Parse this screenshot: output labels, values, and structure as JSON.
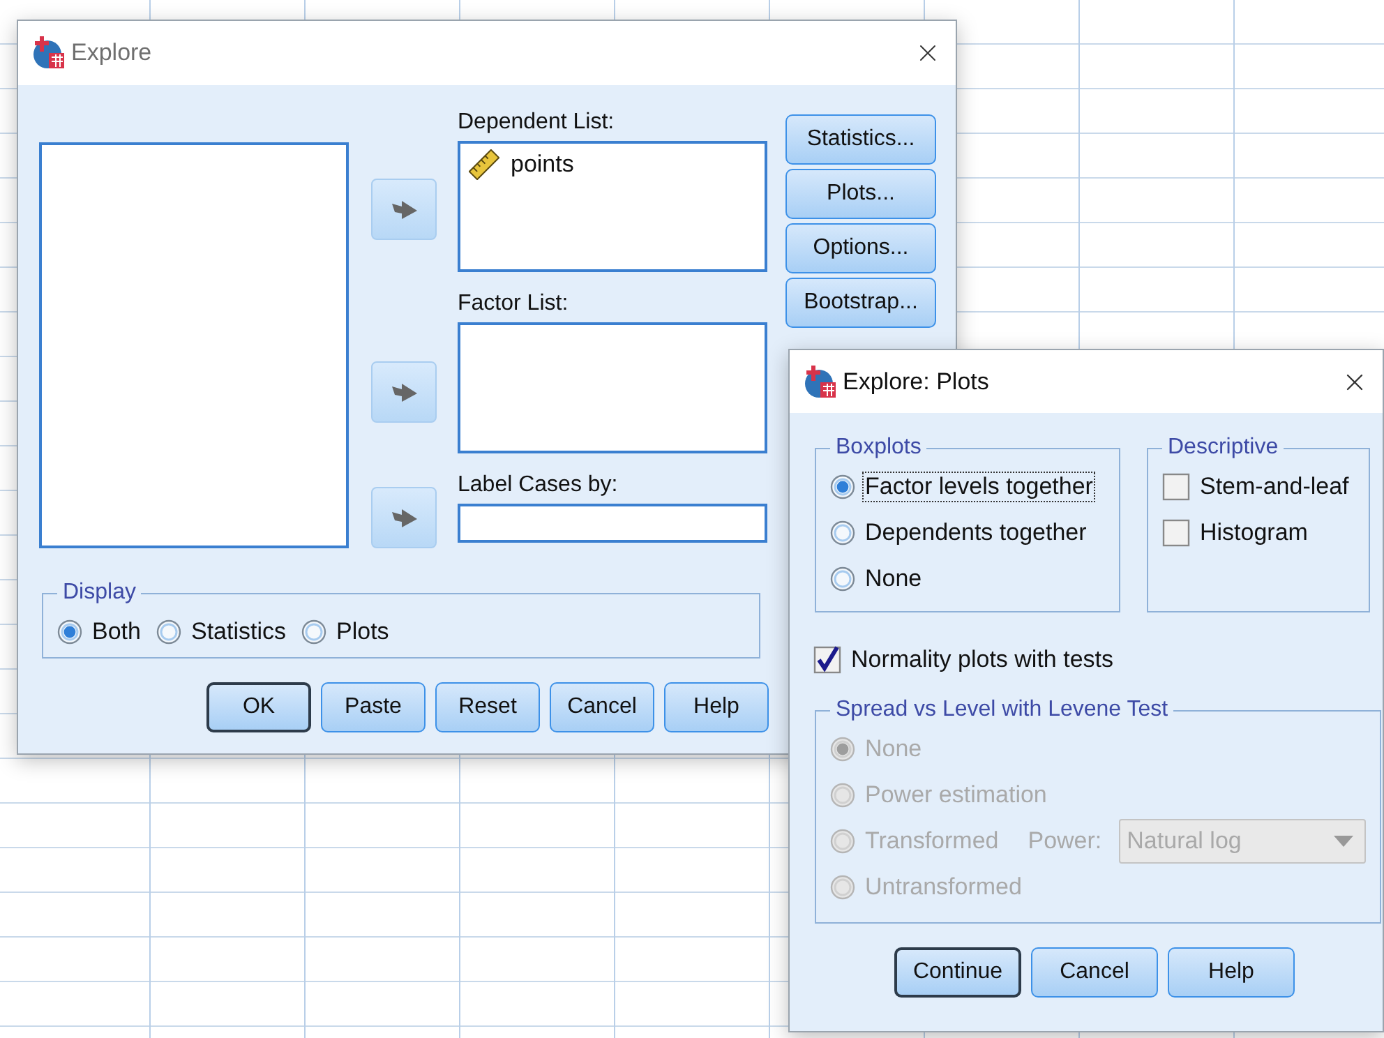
{
  "explore_dialog": {
    "title": "Explore",
    "dependent_list": {
      "label": "Dependent List:",
      "items": [
        {
          "name": "points"
        }
      ]
    },
    "factor_list": {
      "label": "Factor List:"
    },
    "label_cases": {
      "label": "Label Cases by:"
    },
    "side_buttons": [
      "Statistics...",
      "Plots...",
      "Options...",
      "Bootstrap..."
    ],
    "display": {
      "title": "Display",
      "options": [
        {
          "label": "Both",
          "selected": true
        },
        {
          "label": "Statistics",
          "selected": false
        },
        {
          "label": "Plots",
          "selected": false
        }
      ]
    },
    "buttons": [
      {
        "label": "OK",
        "default": true
      },
      {
        "label": "Paste",
        "default": false
      },
      {
        "label": "Reset",
        "default": false
      },
      {
        "label": "Cancel",
        "default": false
      },
      {
        "label": "Help",
        "default": false
      }
    ]
  },
  "plots_dialog": {
    "title": "Explore: Plots",
    "boxplots": {
      "title": "Boxplots",
      "options": [
        {
          "label": "Factor levels together",
          "selected": true,
          "focused": true
        },
        {
          "label": "Dependents together",
          "selected": false,
          "focused": false
        },
        {
          "label": "None",
          "selected": false,
          "focused": false
        }
      ]
    },
    "descriptive": {
      "title": "Descriptive",
      "options": [
        {
          "label": "Stem-and-leaf",
          "checked": false
        },
        {
          "label": "Histogram",
          "checked": false
        }
      ]
    },
    "normality": {
      "label": "Normality plots with tests",
      "checked": true
    },
    "spread": {
      "title": "Spread vs Level with Levene Test",
      "disabled": true,
      "options": [
        {
          "label": "None",
          "selected": true
        },
        {
          "label": "Power estimation",
          "selected": false
        },
        {
          "label": "Transformed",
          "selected": false
        },
        {
          "label": "Untransformed",
          "selected": false
        }
      ],
      "power": {
        "label": "Power:",
        "value": "Natural log"
      }
    },
    "buttons": [
      {
        "label": "Continue",
        "default": true
      },
      {
        "label": "Cancel",
        "default": false
      },
      {
        "label": "Help",
        "default": false
      }
    ]
  }
}
